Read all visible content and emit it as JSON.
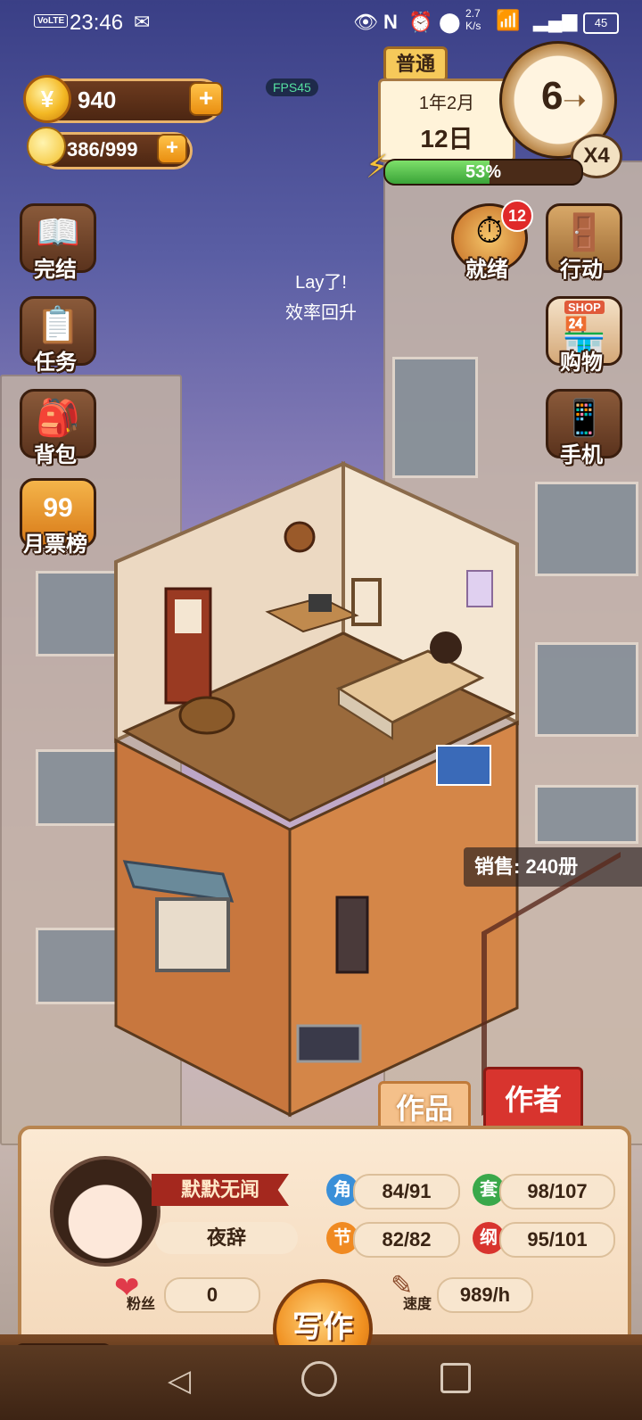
{
  "status_bar": {
    "volte": "VoLTE",
    "time": "23:46",
    "net_speed": "2.7\nK/s",
    "battery": "45"
  },
  "fps": "FPS45",
  "currency": {
    "coins": "940",
    "energy": "386/999"
  },
  "date_panel": {
    "mode": "普通",
    "month": "1年2月",
    "day": "12日",
    "hour": "6",
    "speed": "X4",
    "energy_pct": "53%",
    "energy_fraction": 0.53
  },
  "left_menu": [
    {
      "label": "完结",
      "icon": "book-icon"
    },
    {
      "label": "任务",
      "icon": "checklist-icon"
    },
    {
      "label": "背包",
      "icon": "backpack-icon"
    },
    {
      "label": "月票榜",
      "icon": "ticket-coin-icon",
      "badge": "99"
    }
  ],
  "right_menu": [
    {
      "label": "就绪",
      "icon": "alarm-bell-icon",
      "badge": "12"
    },
    {
      "label": "行动",
      "icon": "door-icon"
    },
    {
      "label": "购物",
      "icon": "shop-icon",
      "sign": "SHOP"
    },
    {
      "label": "手机",
      "icon": "phone-icon"
    }
  ],
  "notice": {
    "line1": "Lay了!",
    "line2": "效率回升"
  },
  "sales": "销售: 240册",
  "tabs": {
    "works": "作品",
    "author": "作者"
  },
  "author": {
    "title": "默默无闻",
    "name": "夜辞",
    "stats": [
      {
        "key": "角",
        "value": "84/91",
        "color": "#3a8fd8"
      },
      {
        "key": "套",
        "value": "98/107",
        "color": "#3aa84a"
      },
      {
        "key": "节",
        "value": "82/82",
        "color": "#f08a22"
      },
      {
        "key": "纲",
        "value": "95/101",
        "color": "#d8342e"
      }
    ],
    "fans_label": "粉丝",
    "fans": "0",
    "speed_label": "速度",
    "speed": "989/h"
  },
  "write_button": "写作",
  "progress": {
    "left_fraction": 1.0,
    "right_fraction": 0.8
  },
  "colors": {
    "wood_dark": "#5b331d",
    "accent_orange": "#f08a22",
    "red_tab": "#d8342e"
  }
}
